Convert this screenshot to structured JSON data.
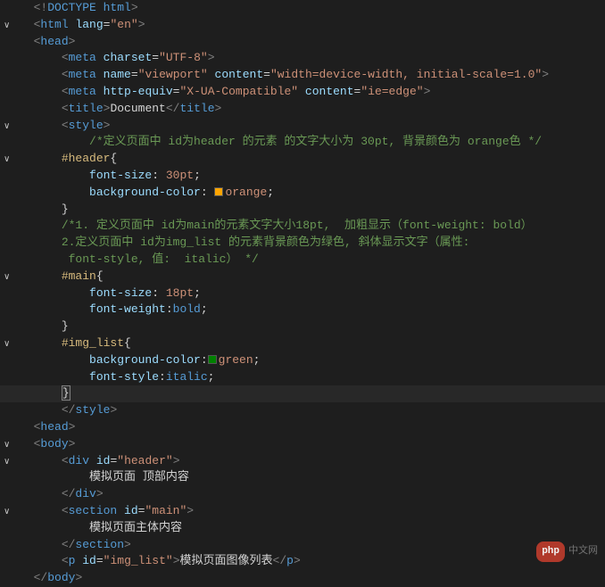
{
  "code": {
    "doctype": "DOCTYPE html",
    "html_tag": "html",
    "lang_attr": "lang",
    "lang_val": "\"en\"",
    "head_tag": "head",
    "meta_tag": "meta",
    "charset_attr": "charset",
    "charset_val": "\"UTF-8\"",
    "name_attr": "name",
    "viewport_val": "\"viewport\"",
    "content_attr": "content",
    "vp_content_val": "\"width=device-width, initial-scale=1.0\"",
    "http_equiv_attr": "http-equiv",
    "xua_val": "\"X-UA-Compatible\"",
    "ie_edge_val": "\"ie=edge\"",
    "title_tag": "title",
    "title_text": "Document",
    "style_tag": "style",
    "comment1": "/*定义页面中 id为header 的元素 的文字大小为 30pt, 背景颜色为 orange色 */",
    "sel_header": "#header",
    "prop_fontsize": "font-size",
    "val_30pt": "30pt",
    "prop_bg": "background-color",
    "val_orange": "orange",
    "comment2a": "/*1. 定义页面中 id为main的元素文字大小18pt,  加粗显示（font-weight: bold）",
    "comment2b": "2.定义页面中 id为img_list 的元素背景颜色为绿色, 斜体显示文字（属性:",
    "comment2c": " font-style, 值:  italic） */",
    "sel_main": "#main",
    "val_18pt": "18pt",
    "prop_fontweight": "font-weight",
    "val_bold": "bold",
    "sel_imglist": "#img_list",
    "val_green": "green",
    "prop_fontstyle": "font-style",
    "val_italic": "italic",
    "body_tag": "body",
    "div_tag": "div",
    "id_attr": "id",
    "id_header_val": "\"header\"",
    "div_header_text": "模拟页面 顶部内容",
    "section_tag": "section",
    "id_main_val": "\"main\"",
    "section_text": "模拟页面主体内容",
    "p_tag": "p",
    "id_imglist_val": "\"img_list\"",
    "p_text": "模拟页面图像列表",
    "close_brace": "}",
    "open_brace": "{",
    "semicolon": ";",
    "colon": ":"
  },
  "colors": {
    "orange": "#ffa500",
    "green": "#008000"
  },
  "watermark": {
    "logo": "php",
    "text": "中文网"
  }
}
